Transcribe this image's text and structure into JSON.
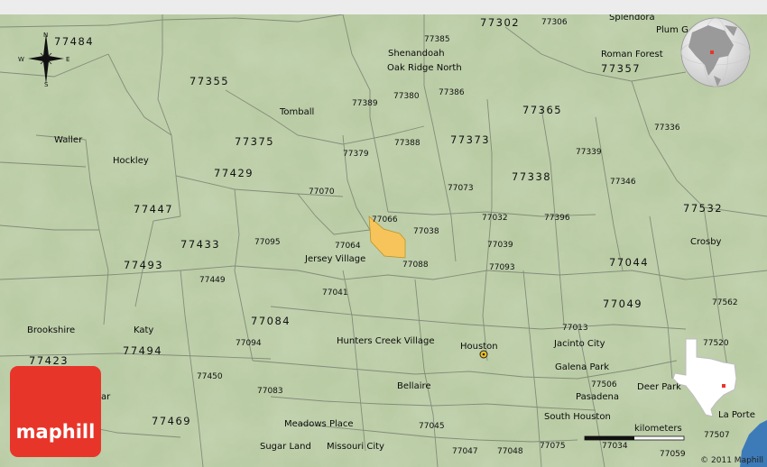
{
  "map": {
    "title": "",
    "highlight_color": "#f6c45a",
    "land_color": "#b6c9a0",
    "water_color": "#3d7ab8",
    "zip_labels": [
      "77484",
      "77355",
      "77375",
      "77429",
      "77447",
      "77433",
      "77493",
      "77449",
      "77423",
      "77494",
      "77469",
      "77095",
      "77070",
      "77379",
      "77389",
      "77388",
      "77380",
      "77386",
      "77385",
      "77302",
      "77306",
      "77357",
      "77365",
      "77373",
      "77339",
      "77338",
      "77336",
      "77346",
      "77073",
      "77066",
      "77038",
      "77032",
      "77396",
      "77532",
      "77064",
      "77088",
      "77039",
      "77093",
      "77044",
      "77041",
      "77084",
      "77094",
      "77450",
      "77083",
      "77045",
      "77047",
      "77048",
      "77075",
      "77034",
      "77059",
      "77013",
      "77049",
      "77562",
      "77520",
      "77506",
      "77507"
    ],
    "city_labels": [
      "Splendora",
      "Shenandoah",
      "Oak Ridge North",
      "Roman Forest",
      "Plum G",
      "Tomball",
      "Waller",
      "Hockley",
      "Jersey Village",
      "Crosby",
      "Brookshire",
      "Katy",
      "Hunters Creek Village",
      "Houston",
      "Jacinto City",
      "Galena Park",
      "Pasadena",
      "Deer Park",
      "Bellaire",
      "South Houston",
      "La Porte",
      "Meadows Place",
      "Sugar Land",
      "Missouri City",
      "ar"
    ],
    "compass": {
      "n": "N",
      "s": "S",
      "e": "E",
      "w": "W"
    },
    "scale_label": "kilometers",
    "copyright": "© 2011 Maphill",
    "logo_text": "maphill"
  }
}
